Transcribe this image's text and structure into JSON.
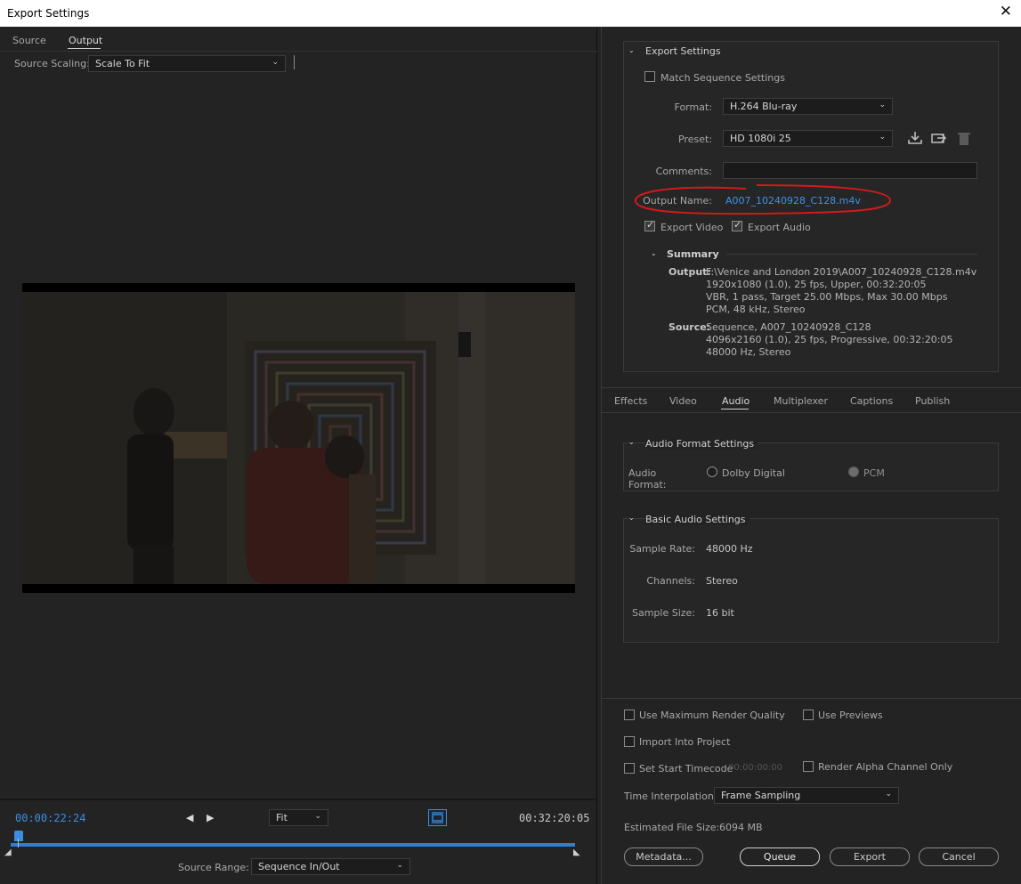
{
  "window": {
    "title": "Export Settings",
    "close": "✕"
  },
  "left": {
    "tabs": [
      "Source",
      "Output"
    ],
    "source_scaling_label": "Source Scaling:",
    "source_scaling_value": "Scale To Fit",
    "timeline": {
      "current_time": "00:00:22:24",
      "zoom": "Fit",
      "duration": "00:32:20:05",
      "source_range_label": "Source Range:",
      "source_range_value": "Sequence In/Out"
    }
  },
  "right": {
    "export_settings": {
      "title": "Export Settings",
      "match_sequence": "Match Sequence Settings",
      "format_label": "Format:",
      "format_value": "H.264 Blu-ray",
      "preset_label": "Preset:",
      "preset_value": "HD 1080i 25",
      "comments_label": "Comments:",
      "comments_value": "",
      "output_name_label": "Output Name:",
      "output_name_value": "A007_10240928_C128.m4v",
      "export_video": "Export Video",
      "export_audio": "Export Audio",
      "summary_title": "Summary",
      "output_label": "Output:",
      "output_lines": [
        "F:\\Venice and London 2019\\A007_10240928_C128.m4v",
        "1920x1080 (1.0), 25 fps, Upper, 00:32:20:05",
        "VBR, 1 pass, Target 25.00 Mbps, Max 30.00 Mbps",
        "PCM, 48 kHz, Stereo"
      ],
      "source_label": "Source:",
      "source_lines": [
        "Sequence, A007_10240928_C128",
        "4096x2160 (1.0), 25 fps, Progressive, 00:32:20:05",
        "48000 Hz, Stereo"
      ]
    },
    "tabs": [
      "Effects",
      "Video",
      "Audio",
      "Multiplexer",
      "Captions",
      "Publish"
    ],
    "audio_format": {
      "title": "Audio Format Settings",
      "label": "Audio Format:",
      "option1": "Dolby Digital",
      "option2": "PCM"
    },
    "basic_audio": {
      "title": "Basic Audio Settings",
      "sample_rate_label": "Sample Rate:",
      "sample_rate_value": "48000 Hz",
      "channels_label": "Channels:",
      "channels_value": "Stereo",
      "sample_size_label": "Sample Size:",
      "sample_size_value": "16 bit"
    },
    "bottom": {
      "max_render": "Use Maximum Render Quality",
      "use_previews": "Use Previews",
      "import_project": "Import Into Project",
      "set_start_tc": "Set Start Timecode",
      "start_tc_value": "00:00:00:00",
      "render_alpha": "Render Alpha Channel Only",
      "time_interp_label": "Time Interpolation:",
      "time_interp_value": "Frame Sampling",
      "est_size_label": "Estimated File Size:",
      "est_size_value": "6094 MB",
      "metadata_btn": "Metadata...",
      "queue_btn": "Queue",
      "export_btn": "Export",
      "cancel_btn": "Cancel"
    }
  },
  "colors": {
    "accent_blue": "#3b8de0",
    "link_blue": "#3d93e6",
    "annotation_red": "#d01b1b"
  }
}
